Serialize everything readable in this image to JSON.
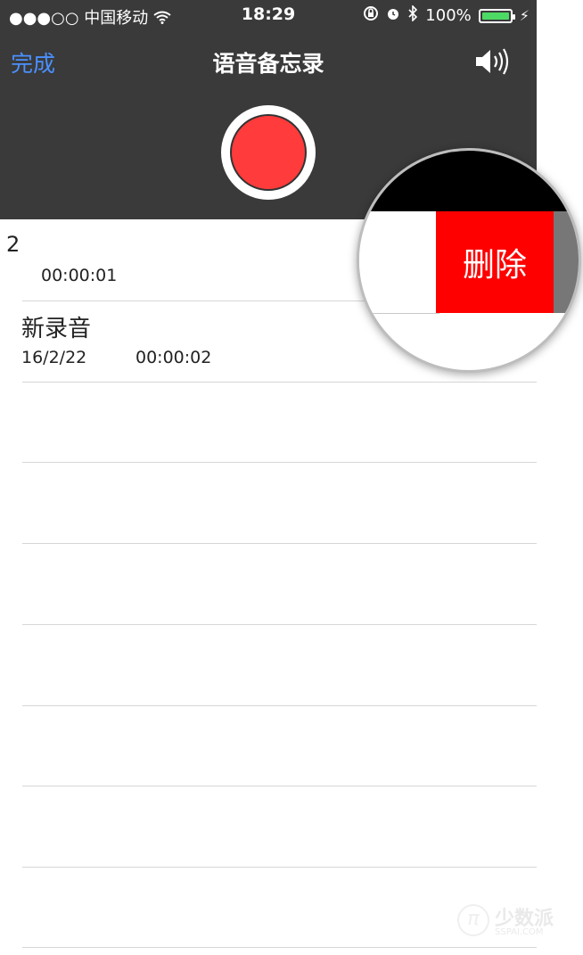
{
  "status_bar": {
    "carrier": "●●●○○ 中国移动",
    "time": "18:29",
    "battery": "100%",
    "battery_fill": 1.0
  },
  "nav": {
    "done_label": "完成",
    "title": "语音备忘录"
  },
  "recordings": [
    {
      "name": "2",
      "date": "",
      "duration": "00:00:01"
    },
    {
      "name": "新录音",
      "date": "16/2/22",
      "duration": "00:00:02"
    }
  ],
  "swipe_action": {
    "delete_label": "删除"
  },
  "watermark": {
    "brand": "少数派",
    "url": "SSPAI.COM"
  },
  "colors": {
    "header_bg": "#3a3a3a",
    "accent": "#4a90ff",
    "record_red": "#ff3b3b",
    "delete_red": "#ff0000",
    "battery_green": "#4cd964"
  },
  "icons": [
    "wifi-icon",
    "rotation-lock-icon",
    "alarm-icon",
    "bluetooth-icon",
    "battery-icon",
    "charging-bolt-icon",
    "speaker-icon",
    "record-icon"
  ]
}
